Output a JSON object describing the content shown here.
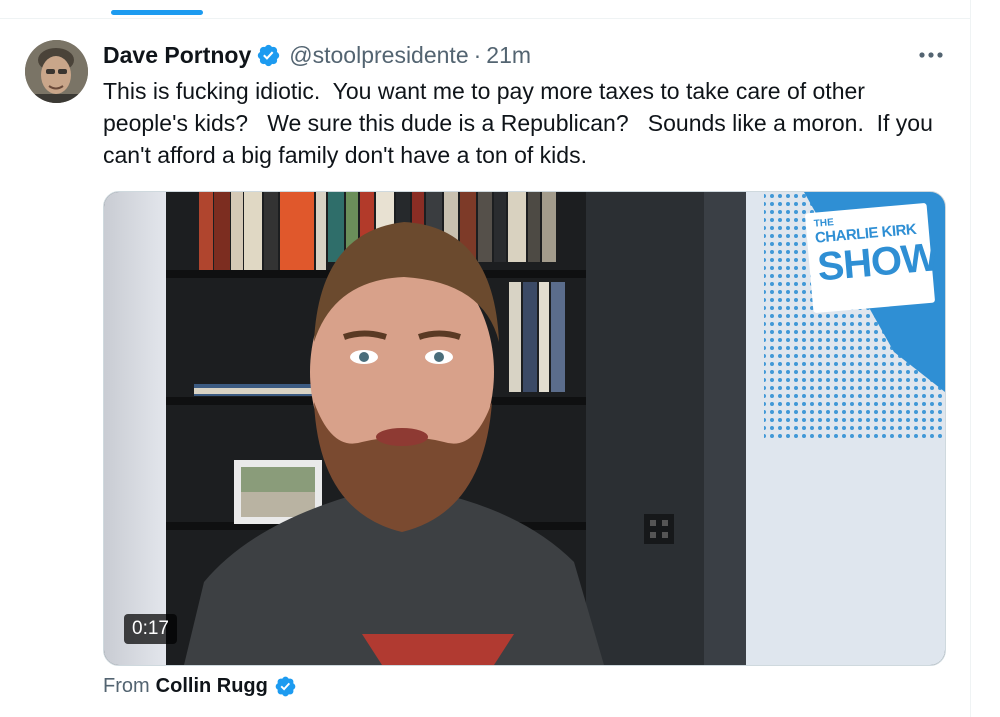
{
  "tweet": {
    "author_name": "Dave Portnoy",
    "handle": "@stoolpresidente",
    "separator": "·",
    "time": "21m",
    "text": "This is fucking idiotic.  You want me to pay more taxes to take care of other people's kids?   We sure this dude is a Republican?   Sounds like a moron.  If you can't afford a big family don't have a ton of kids.",
    "verified_icon": "verified-badge-icon",
    "more_icon": "more-horizontal-icon"
  },
  "video": {
    "duration": "0:17",
    "logo": {
      "line1": "THE",
      "line2": "CHARLIE KIRK",
      "line3": "SHOW"
    }
  },
  "attribution": {
    "prefix": "From",
    "source": "Collin Rugg"
  },
  "colors": {
    "accent": "#1d9bf0",
    "text_primary": "#0f1419",
    "text_secondary": "#536471",
    "border": "#cfd9de",
    "logo_blue": "#2f8fd4"
  }
}
